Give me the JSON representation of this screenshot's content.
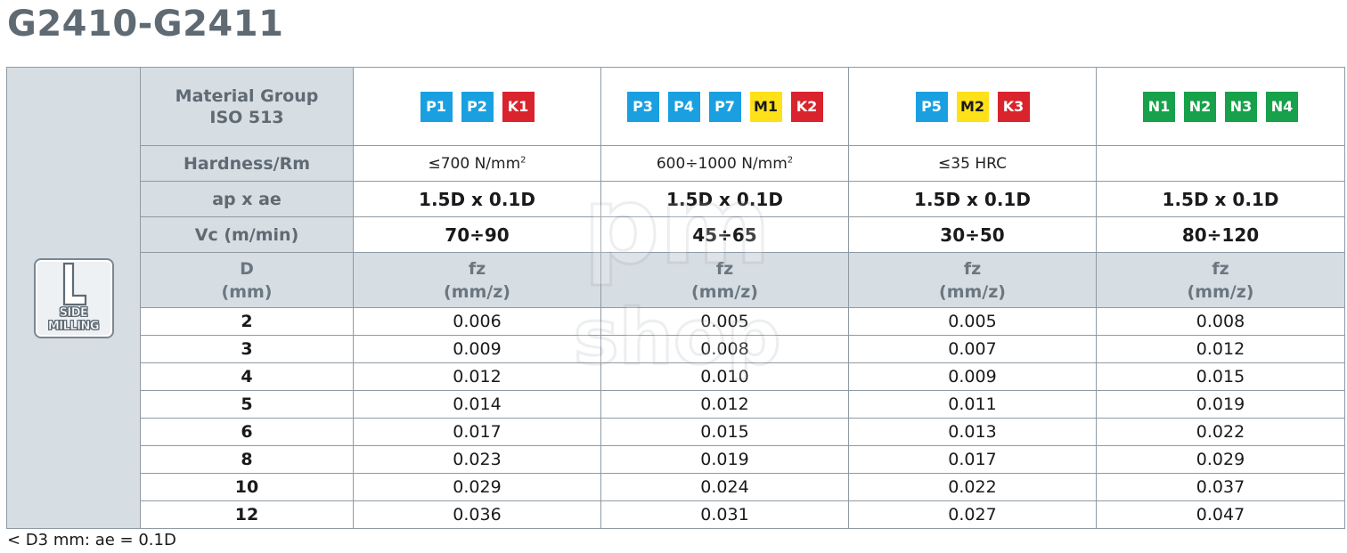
{
  "title": "G2410-G2411",
  "badge": {
    "letter": "L",
    "label": "SIDE MILLING",
    "icon": "side-milling-icon"
  },
  "header": {
    "material_group": "Material Group\nISO 513",
    "hardness": "Hardness/Rm",
    "ap_ae": "ap x ae",
    "vc": "Vc (m/min)",
    "d_label": "D\n(mm)",
    "fz_label": "fz\n(mm/z)"
  },
  "groups": [
    {
      "chips": [
        {
          "code": "P1",
          "color": "#1aa0e0"
        },
        {
          "code": "P2",
          "color": "#1aa0e0"
        },
        {
          "code": "K1",
          "color": "#d9232d"
        }
      ],
      "hardness": "≤700 N/mm",
      "hardness_sup": "2",
      "ap_ae": "1.5D x 0.1D",
      "vc": "70÷90"
    },
    {
      "chips": [
        {
          "code": "P3",
          "color": "#1aa0e0"
        },
        {
          "code": "P4",
          "color": "#1aa0e0"
        },
        {
          "code": "P7",
          "color": "#1aa0e0"
        },
        {
          "code": "M1",
          "color": "#ffe11a"
        },
        {
          "code": "K2",
          "color": "#d9232d"
        }
      ],
      "hardness": "600÷1000 N/mm",
      "hardness_sup": "2",
      "ap_ae": "1.5D x 0.1D",
      "vc": "45÷65"
    },
    {
      "chips": [
        {
          "code": "P5",
          "color": "#1aa0e0"
        },
        {
          "code": "M2",
          "color": "#ffe11a"
        },
        {
          "code": "K3",
          "color": "#d9232d"
        }
      ],
      "hardness": "≤35 HRC",
      "hardness_sup": "",
      "ap_ae": "1.5D x 0.1D",
      "vc": "30÷50"
    },
    {
      "chips": [
        {
          "code": "N1",
          "color": "#16a14a"
        },
        {
          "code": "N2",
          "color": "#16a14a"
        },
        {
          "code": "N3",
          "color": "#16a14a"
        },
        {
          "code": "N4",
          "color": "#16a14a"
        }
      ],
      "hardness": "",
      "hardness_sup": "",
      "ap_ae": "1.5D x 0.1D",
      "vc": "80÷120"
    }
  ],
  "rows": [
    {
      "d": "2",
      "fz": [
        "0.006",
        "0.005",
        "0.005",
        "0.008"
      ]
    },
    {
      "d": "3",
      "fz": [
        "0.009",
        "0.008",
        "0.007",
        "0.012"
      ]
    },
    {
      "d": "4",
      "fz": [
        "0.012",
        "0.010",
        "0.009",
        "0.015"
      ]
    },
    {
      "d": "5",
      "fz": [
        "0.014",
        "0.012",
        "0.011",
        "0.019"
      ]
    },
    {
      "d": "6",
      "fz": [
        "0.017",
        "0.015",
        "0.013",
        "0.022"
      ]
    },
    {
      "d": "8",
      "fz": [
        "0.023",
        "0.019",
        "0.017",
        "0.029"
      ]
    },
    {
      "d": "10",
      "fz": [
        "0.029",
        "0.024",
        "0.022",
        "0.037"
      ]
    },
    {
      "d": "12",
      "fz": [
        "0.036",
        "0.031",
        "0.027",
        "0.047"
      ]
    }
  ],
  "watermark": {
    "line1": "pm",
    "line2": "shop"
  },
  "footnote": "< D3 mm: ae = 0.1D"
}
